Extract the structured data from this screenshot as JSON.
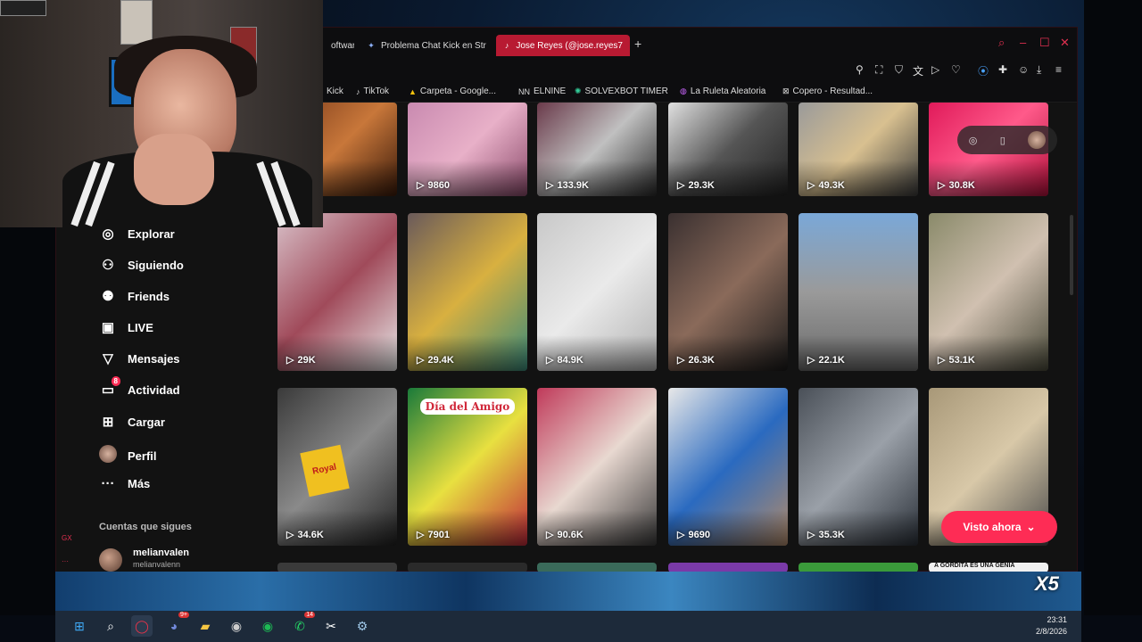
{
  "browser": {
    "tabs": [
      {
        "label": "oftware",
        "icon": "generic-icon"
      },
      {
        "label": "Problema Chat Kick en Str",
        "icon": "gemini-icon"
      },
      {
        "label": "Jose Reyes (@jose.reyes7",
        "icon": "tiktok-icon"
      }
    ],
    "bookmarks": [
      {
        "label": "Kick",
        "icon": "kick-icon"
      },
      {
        "label": "TikTok",
        "icon": "tiktok-icon"
      },
      {
        "label": "Carpeta - Google...",
        "icon": "drive-icon"
      },
      {
        "label": "ELNINE",
        "icon": "elnine-icon"
      },
      {
        "label": "SOLVEXBOT TIMER",
        "icon": "solvex-icon"
      },
      {
        "label": "La Ruleta Aleatoria",
        "icon": "wheel-icon"
      },
      {
        "label": "Copero - Resultad...",
        "icon": "copero-icon"
      }
    ]
  },
  "sidebar": {
    "items": [
      {
        "label": "Explorar",
        "icon": "compass-icon"
      },
      {
        "label": "Siguiendo",
        "icon": "user-follow-icon"
      },
      {
        "label": "Friends",
        "icon": "friends-icon"
      },
      {
        "label": "LIVE",
        "icon": "live-tv-icon"
      },
      {
        "label": "Mensajes",
        "icon": "send-icon"
      },
      {
        "label": "Actividad",
        "icon": "activity-icon",
        "badge": "8"
      },
      {
        "label": "Cargar",
        "icon": "upload-plus-icon"
      },
      {
        "label": "Perfil",
        "icon": "avatar"
      },
      {
        "label": "Más",
        "icon": "more-dots-icon"
      }
    ],
    "following_heading": "Cuentas que sigues",
    "following": [
      {
        "name": "melianvalen",
        "username": "melianvalenn"
      }
    ]
  },
  "videos": {
    "rows": [
      [
        "",
        "9860",
        "133.9K",
        "29.3K",
        "49.3K",
        "30.8K"
      ],
      [
        "29K",
        "29.4K",
        "84.9K",
        "26.3K",
        "22.1K",
        "53.1K"
      ],
      [
        "34.6K",
        "7901",
        "90.6K",
        "9690",
        "35.3K",
        ""
      ]
    ],
    "overlay_dia_amigo": "Día del Amigo",
    "overlay_royal": "Royal",
    "overlay_bottom_text": "A GORDITA ES UNA GENIA"
  },
  "visto_ahora": "Visto ahora",
  "watermark": "X5",
  "taskbar": {
    "badges": {
      "discord": "9+",
      "whatsapp": "14"
    },
    "time": "23:31",
    "date": "2/8/2026"
  },
  "colors": {
    "accent": "#fe2c55",
    "opera": "#b81a32"
  }
}
